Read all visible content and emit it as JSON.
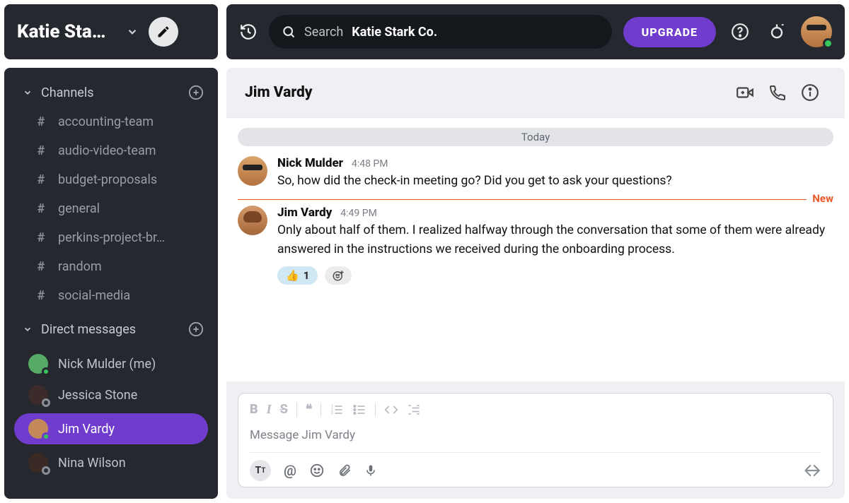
{
  "workspace": {
    "name_truncated": "Katie Sta…",
    "search_label": "Search",
    "search_workspace": "Katie Stark Co.",
    "upgrade_label": "UPGRADE"
  },
  "sidebar": {
    "channels_label": "Channels",
    "dms_label": "Direct messages",
    "channels": [
      {
        "name": "accounting-team"
      },
      {
        "name": "audio-video-team"
      },
      {
        "name": "budget-proposals"
      },
      {
        "name": "general"
      },
      {
        "name": "perkins-project-br…"
      },
      {
        "name": "random"
      },
      {
        "name": "social-media"
      }
    ],
    "dms": [
      {
        "name": "Nick Mulder (me)",
        "presence": "online",
        "color": "#c98a4e"
      },
      {
        "name": "Jessica Stone",
        "presence": "offline",
        "color": "#3c2b2b"
      },
      {
        "name": "Jim Vardy",
        "presence": "online",
        "color": "#c4895b",
        "active": true
      },
      {
        "name": "Nina Wilson",
        "presence": "offline",
        "color": "#3a2a25"
      }
    ]
  },
  "conversation": {
    "title": "Jim Vardy",
    "date_separator": "Today",
    "new_label": "New",
    "messages": [
      {
        "author": "Nick Mulder",
        "time": "4:48 PM",
        "text": "So, how did the check-in meeting go? Did you get to ask your questions?"
      },
      {
        "author": "Jim Vardy",
        "time": "4:49 PM",
        "text": "Only about half of them. I realized halfway through the conversation that some of them were already answered in the instructions we received during the onboarding process.",
        "reactions": [
          {
            "emoji": "👍",
            "count": 1
          }
        ]
      }
    ],
    "composer_placeholder": "Message Jim Vardy"
  }
}
